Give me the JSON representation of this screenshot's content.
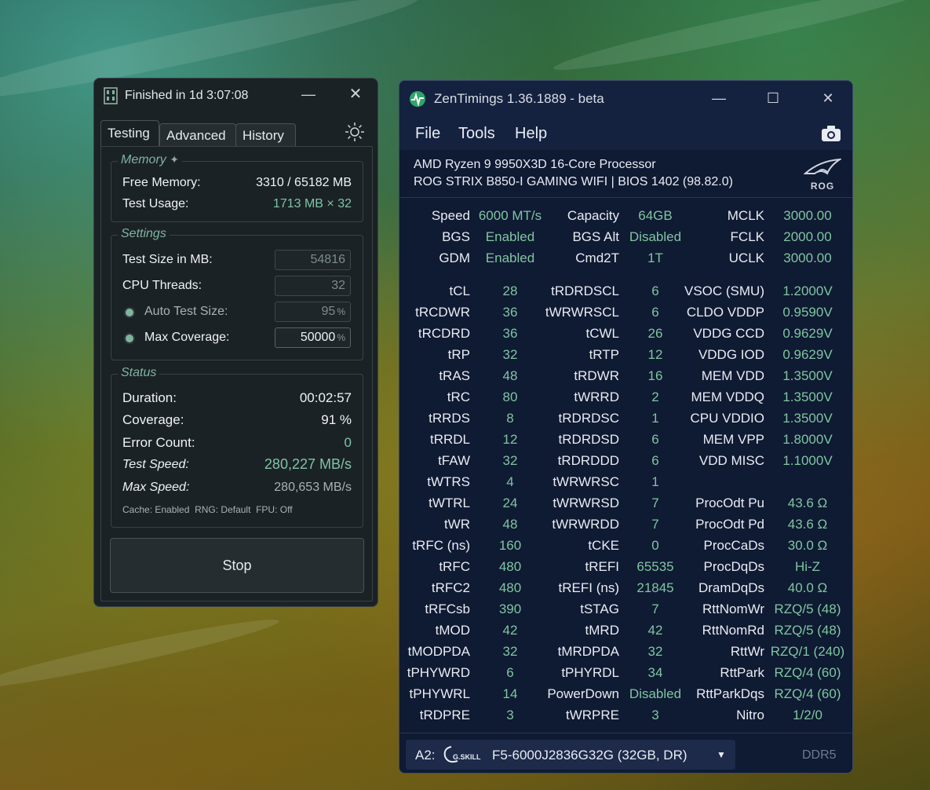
{
  "testmem": {
    "title": "Finished in 1d 3:07:08",
    "tabs": [
      "Testing",
      "Advanced",
      "History"
    ],
    "memory": {
      "legend": "Memory",
      "free_label": "Free Memory:",
      "free_value": "3310 / 65182 MB",
      "usage_label": "Test Usage:",
      "usage_value": "1713 MB × 32"
    },
    "settings": {
      "legend": "Settings",
      "test_size_label": "Test Size in MB:",
      "test_size_value": "54816",
      "cpu_threads_label": "CPU Threads:",
      "cpu_threads_value": "32",
      "auto_test_size_label": "Auto Test Size:",
      "auto_test_size_value": "95",
      "max_coverage_label": "Max Coverage:",
      "max_coverage_value": "50000",
      "percent_unit": "%"
    },
    "status": {
      "legend": "Status",
      "duration_label": "Duration:",
      "duration_value": "00:02:57",
      "coverage_label": "Coverage:",
      "coverage_value": "91 %",
      "error_label": "Error Count:",
      "error_value": "0",
      "test_speed_label": "Test Speed:",
      "test_speed_value": "280,227 MB/s",
      "max_speed_label": "Max Speed:",
      "max_speed_value": "280,653 MB/s",
      "info_line": "Cache: Enabled  RNG: Default  FPU: Off"
    },
    "stop_label": "Stop"
  },
  "zentimings": {
    "title": "ZenTimings 1.36.1889 - beta",
    "menu": [
      "File",
      "Tools",
      "Help"
    ],
    "cpu": "AMD Ryzen 9 9950X3D 16-Core Processor",
    "board": "ROG STRIX B850-I GAMING WIFI | BIOS 1402 (98.82.0)",
    "rog_text": "ROG",
    "top_rows": [
      [
        "Speed",
        "6000 MT/s",
        "Capacity",
        "64GB",
        "MCLK",
        "3000.00"
      ],
      [
        "BGS",
        "Enabled",
        "BGS Alt",
        "Disabled",
        "FCLK",
        "2000.00"
      ],
      [
        "GDM",
        "Enabled",
        "Cmd2T",
        "1T",
        "UCLK",
        "3000.00"
      ]
    ],
    "timing_rows": [
      [
        "tCL",
        "28",
        "tRDRDSCL",
        "6",
        "VSOC (SMU)",
        "1.2000V"
      ],
      [
        "tRCDWR",
        "36",
        "tWRWRSCL",
        "6",
        "CLDO VDDP",
        "0.9590V"
      ],
      [
        "tRCDRD",
        "36",
        "tCWL",
        "26",
        "VDDG CCD",
        "0.9629V"
      ],
      [
        "tRP",
        "32",
        "tRTP",
        "12",
        "VDDG IOD",
        "0.9629V"
      ],
      [
        "tRAS",
        "48",
        "tRDWR",
        "16",
        "MEM VDD",
        "1.3500V"
      ],
      [
        "tRC",
        "80",
        "tWRRD",
        "2",
        "MEM VDDQ",
        "1.3500V"
      ],
      [
        "tRRDS",
        "8",
        "tRDRDSC",
        "1",
        "CPU VDDIO",
        "1.3500V"
      ],
      [
        "tRRDL",
        "12",
        "tRDRDSD",
        "6",
        "MEM VPP",
        "1.8000V"
      ],
      [
        "tFAW",
        "32",
        "tRDRDDD",
        "6",
        "VDD MISC",
        "1.1000V"
      ],
      [
        "tWTRS",
        "4",
        "tWRWRSC",
        "1",
        "",
        ""
      ],
      [
        "tWTRL",
        "24",
        "tWRWRSD",
        "7",
        "ProcOdt Pu",
        "43.6 Ω"
      ],
      [
        "tWR",
        "48",
        "tWRWRDD",
        "7",
        "ProcOdt Pd",
        "43.6 Ω"
      ],
      [
        "tRFC (ns)",
        "160",
        "tCKE",
        "0",
        "ProcCaDs",
        "30.0 Ω"
      ],
      [
        "tRFC",
        "480",
        "tREFI",
        "65535",
        "ProcDqDs",
        "Hi-Z"
      ],
      [
        "tRFC2",
        "480",
        "tREFI (ns)",
        "21845",
        "DramDqDs",
        "40.0 Ω"
      ],
      [
        "tRFCsb",
        "390",
        "tSTAG",
        "7",
        "RttNomWr",
        "RZQ/5 (48)"
      ],
      [
        "tMOD",
        "42",
        "tMRD",
        "42",
        "RttNomRd",
        "RZQ/5 (48)"
      ],
      [
        "tMODPDA",
        "32",
        "tMRDPDA",
        "32",
        "RttWr",
        "RZQ/1 (240)"
      ],
      [
        "tPHYWRD",
        "6",
        "tPHYRDL",
        "34",
        "RttPark",
        "RZQ/4 (60)"
      ],
      [
        "tPHYWRL",
        "14",
        "PowerDown",
        "Disabled",
        "RttParkDqs",
        "RZQ/4 (60)"
      ],
      [
        "tRDPRE",
        "3",
        "tWRPRE",
        "3",
        "Nitro",
        "1/2/0"
      ]
    ],
    "dimm_slot": "A2:",
    "dimm_brand": "G.SKILL",
    "dimm_part": "F5-6000J2836G32G (32GB, DR)",
    "ddr_type": "DDR5"
  },
  "colors": {
    "accent_green": "#7fc6a0",
    "testmem_bg": "#1b2226",
    "zentimings_bg": "#0f1a33"
  },
  "icons": [
    "testmem-app-icon",
    "minimize-icon",
    "close-icon",
    "theme-sun-icon",
    "zentimings-app-icon",
    "maximize-icon",
    "camera-icon",
    "rog-logo",
    "gskill-logo",
    "chevron-down-icon"
  ]
}
